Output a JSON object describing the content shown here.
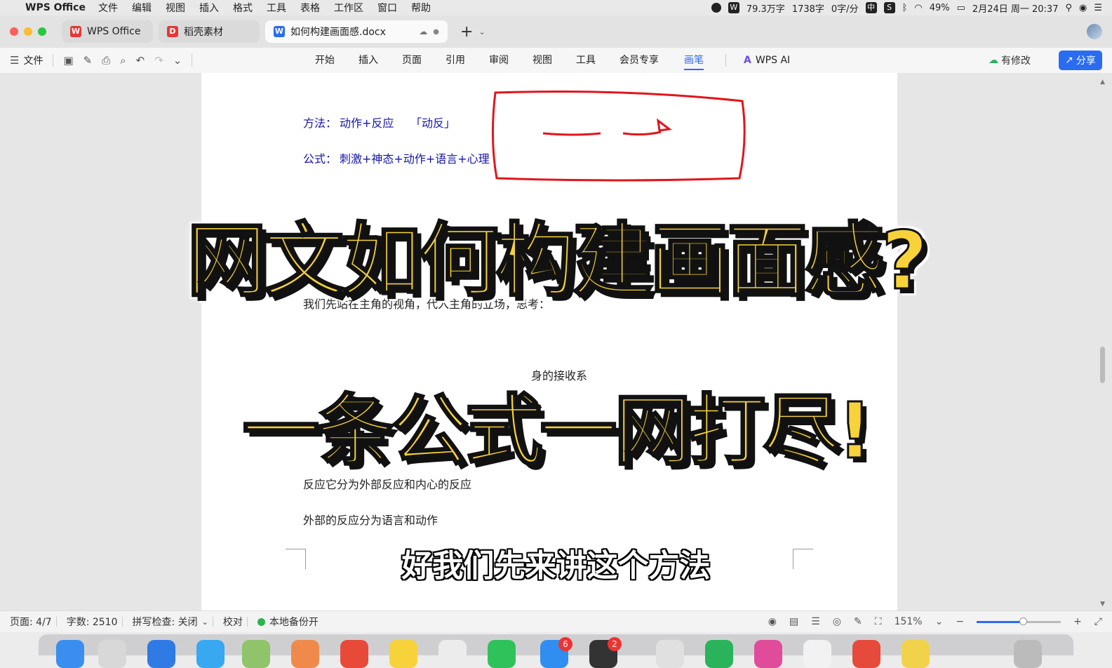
{
  "menubar": {
    "app_name": "WPS Office",
    "menus": [
      "文件",
      "编辑",
      "视图",
      "插入",
      "格式",
      "工具",
      "表格",
      "工作区",
      "窗口",
      "帮助"
    ],
    "status": {
      "word_count_total": "79.3万字",
      "word_count_today": "1738字",
      "speed": "0字/分",
      "input_method": "中",
      "battery": "49%",
      "datetime": "2月24日 周一  20:37"
    }
  },
  "tabs": [
    {
      "label": "WPS Office",
      "logo": "W",
      "color": "#e53935"
    },
    {
      "label": "稻壳素材",
      "logo": "D",
      "color": "#e53935"
    },
    {
      "label": "如何构建画面感.docx",
      "logo": "W",
      "color": "#2a6cf0"
    }
  ],
  "ribbon": {
    "file_label": "文件",
    "tabs": [
      "开始",
      "插入",
      "页面",
      "引用",
      "审阅",
      "视图",
      "工具",
      "会员专享",
      "画笔"
    ],
    "active_tab": "画笔",
    "ai_label": "WPS AI",
    "modified_label": "有修改",
    "share_label": "分享"
  },
  "document": {
    "method_label": "方法：",
    "method_value": "动作+反应",
    "method_short": "「动反」",
    "formula_label": "公式：",
    "formula_value": "刺激+神态+动作+语言+心理",
    "line1": "我们先站在主角的视角，代入主角的立场，思考：",
    "line2": "身的接收系",
    "line3": "反应它分为外部反应和内心的反应",
    "line4": "外部的反应分为语言和动作"
  },
  "overlay": {
    "title1": "网文如何构建画面感?",
    "title2": "一条公式一网打尽!",
    "subtitle": "好我们先来讲这个方法"
  },
  "statusbar": {
    "page": "页面: 4/7",
    "words": "字数: 2510",
    "spellcheck": "拼写检查: 关闭",
    "proofread": "校对",
    "backup": "本地备份开",
    "zoom": "151%",
    "zoom_fraction": 0.55
  },
  "dock": {
    "badges": [
      "6",
      "2"
    ]
  }
}
